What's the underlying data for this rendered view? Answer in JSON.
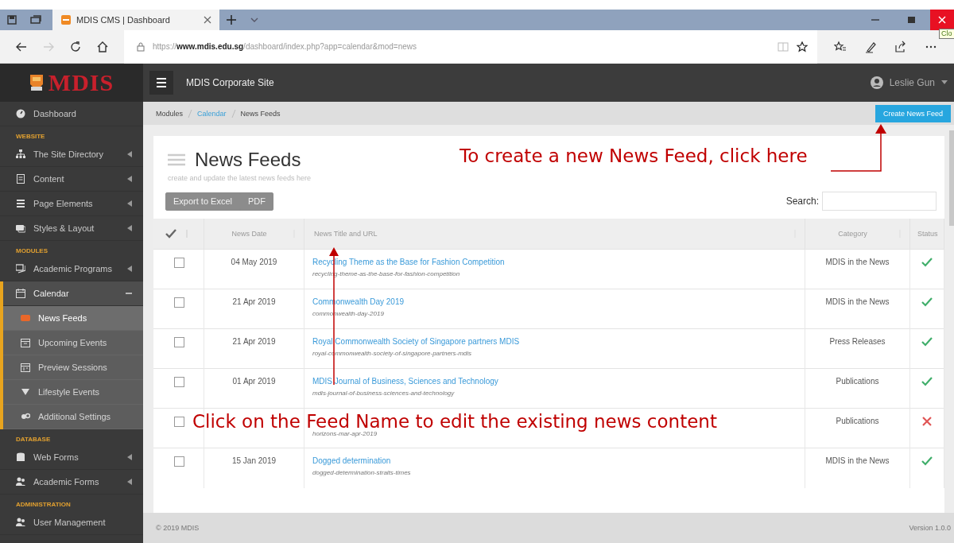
{
  "browser": {
    "tab": {
      "title": "MDIS CMS | Dashboard"
    },
    "url": "https://**www.mdis.edu.sg**/dashboard/index.php?app=calendar&mod=news",
    "tooltip": "Clo"
  },
  "header": {
    "logo": "MDIS",
    "site": "MDIS Corporate Site",
    "user": "Leslie Gun"
  },
  "sidebar": [
    {
      "kind": "link",
      "label": "Dashboard"
    },
    {
      "kind": "heading",
      "label": "WEBSITE"
    },
    {
      "kind": "link",
      "label": "The Site Directory",
      "expanded": false
    },
    {
      "kind": "link",
      "label": "Content",
      "expanded": false
    },
    {
      "kind": "link",
      "label": "Page Elements",
      "expanded": false
    },
    {
      "kind": "link",
      "label": "Styles & Layout",
      "expanded": false
    },
    {
      "kind": "heading",
      "label": "MODULES"
    },
    {
      "kind": "link",
      "label": "Academic Programs",
      "expanded": false
    },
    {
      "kind": "link",
      "label": "Calendar",
      "expanded": true,
      "children": [
        {
          "label": "News Feeds",
          "selected": true
        },
        {
          "label": "Upcoming Events",
          "selected": false
        },
        {
          "label": "Preview Sessions",
          "selected": false
        },
        {
          "label": "Lifestyle Events",
          "selected": false
        },
        {
          "label": "Additional Settings",
          "selected": false
        }
      ]
    },
    {
      "kind": "heading",
      "label": "DATABASE"
    },
    {
      "kind": "link",
      "label": "Web Forms",
      "expanded": false
    },
    {
      "kind": "link",
      "label": "Academic Forms",
      "expanded": false
    },
    {
      "kind": "heading",
      "label": "ADMINISTRATION"
    },
    {
      "kind": "link",
      "label": "User Management"
    }
  ],
  "breadcrumb": [
    {
      "label": "Modules",
      "link": false
    },
    {
      "label": "Calendar",
      "link": true
    },
    {
      "label": "News Feeds",
      "link": false
    }
  ],
  "create_button": "Create News Feed",
  "page": {
    "title": "News Feeds",
    "subtitle": "create and update the latest news feeds here"
  },
  "export_buttons": [
    "Export to Excel",
    "PDF"
  ],
  "search": {
    "label": "Search:"
  },
  "table": {
    "columns": [
      "News Date",
      "News Title and URL",
      "Category",
      "Status"
    ],
    "rows": [
      {
        "checked": false,
        "date": "04 May 2019",
        "title": "Recycling Theme as the Base for Fashion Competition",
        "slug": "recycling-theme-as-the-base-for-fashion-competition",
        "category": "MDIS in the News",
        "published": true
      },
      {
        "checked": false,
        "date": "21 Apr 2019",
        "title": "Commonwealth Day 2019",
        "slug": "commonwealth-day-2019",
        "category": "MDIS in the News",
        "published": true
      },
      {
        "checked": false,
        "date": "21 Apr 2019",
        "title": "Royal Commonwealth Society of Singapore partners MDIS",
        "slug": "royal-commonwealth-society-of-singapore-partners-mdis",
        "category": "Press Releases",
        "published": true
      },
      {
        "checked": false,
        "date": "01 Apr 2019",
        "title": "MDIS Journal of Business, Sciences and Technology",
        "slug": "mdis-journal-of-business-sciences-and-technology",
        "category": "Publications",
        "published": true
      },
      {
        "checked": false,
        "slug": "horizons-mar-apr-2019",
        "category": "Publications",
        "published": false
      },
      {
        "checked": false,
        "date": "15 Jan 2019",
        "title": "Dogged determination",
        "slug": "dogged-determination-straits-times",
        "category": "MDIS in the News",
        "published": true
      }
    ]
  },
  "footer": {
    "copyright": "© 2019 MDIS",
    "version": "Version 1.0.0"
  },
  "annotations": [
    {
      "text": "To create a new News Feed, click here"
    },
    {
      "text": "Click on the Feed Name to edit the existing news content"
    }
  ]
}
